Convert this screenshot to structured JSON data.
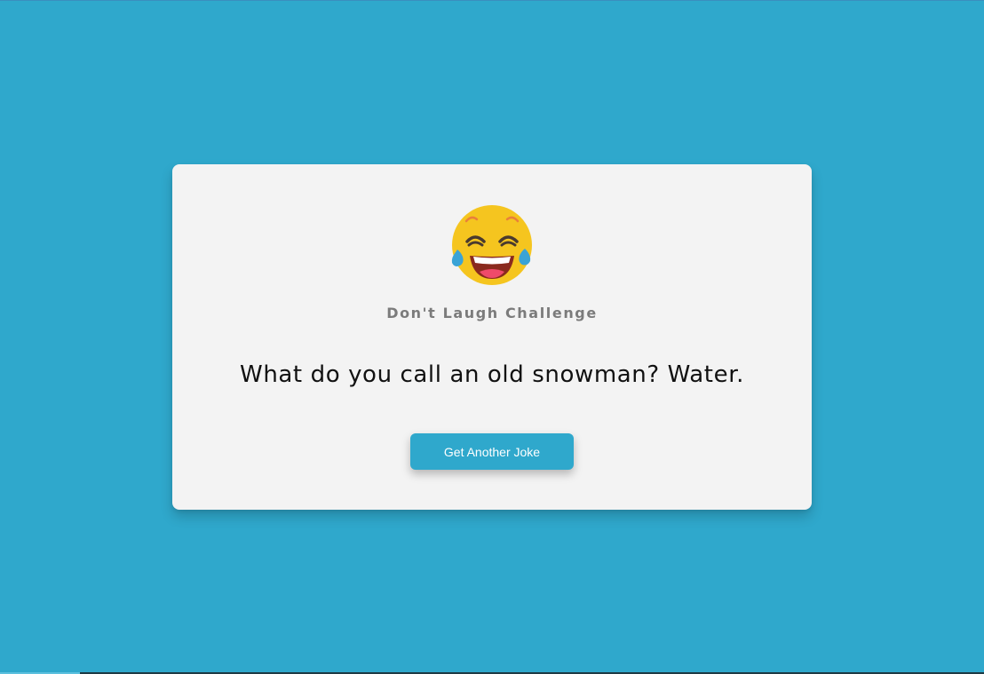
{
  "page": {
    "background_color": "#2fa8cc"
  },
  "card": {
    "emoji_icon": "laughing-with-tears-icon",
    "subtitle": "Don't Laugh Challenge",
    "joke": "What do you call an old snowman? Water.",
    "button_label": "Get Another Joke"
  },
  "colors": {
    "accent": "#2fa8cc",
    "card_background": "#f3f3f3",
    "subtitle_text": "#7b7b7b",
    "joke_text": "#111111",
    "button_text": "#ffffff"
  }
}
